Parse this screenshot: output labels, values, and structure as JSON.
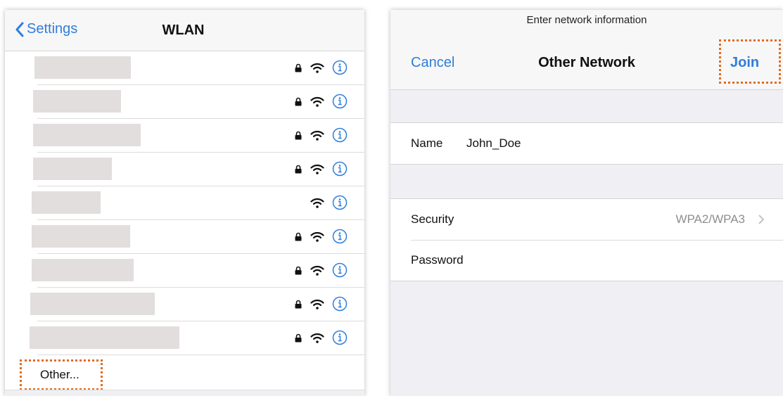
{
  "wlan_panel": {
    "back_label": "Settings",
    "title": "WLAN",
    "networks": [
      {
        "name_redacted": true,
        "secured": true
      },
      {
        "name_redacted": true,
        "secured": true
      },
      {
        "name_redacted": true,
        "secured": true
      },
      {
        "name_redacted": true,
        "secured": true
      },
      {
        "name_redacted": true,
        "secured": false
      },
      {
        "name_redacted": true,
        "secured": true
      },
      {
        "name_redacted": true,
        "secured": true
      },
      {
        "name_redacted": true,
        "secured": true
      },
      {
        "name_redacted": true,
        "secured": true
      }
    ],
    "other_label": "Other..."
  },
  "join_sheet": {
    "prompt": "Enter network information",
    "cancel_label": "Cancel",
    "title": "Other Network",
    "join_label": "Join",
    "name_label": "Name",
    "name_value": "John_Doe",
    "security_label": "Security",
    "security_value": "WPA2/WPA3",
    "password_label": "Password"
  },
  "icons": {
    "back": "chevron-left-icon",
    "lock": "lock-icon",
    "wifi": "wifi-icon",
    "info": "info-icon",
    "disclosure": "chevron-right-icon"
  },
  "colors": {
    "accent": "#2f7ddb",
    "highlight_outline": "#e36b1e",
    "redaction_block": "#e2dedd",
    "secondary_text": "#8e8e93",
    "grouped_background": "#efeff4"
  }
}
